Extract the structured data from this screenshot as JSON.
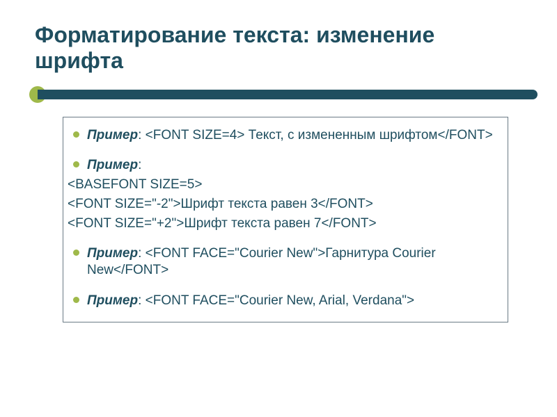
{
  "title": "Форматирование текста: изменение шрифта",
  "label": "Пример",
  "items": {
    "ex1_code": ": <FONT SIZE=4> Текст, с измененным шрифтом</FONT>",
    "ex2_sep": ":",
    "ex2_line1": "<BASEFONT SIZE=5>",
    "ex2_line2": "<FONT SIZE=\"-2\">Шрифт текста равен 3</FONT>",
    "ex2_line3": "<FONT SIZE=\"+2\">Шрифт текста равен 7</FONT>",
    "ex3_code": ": <FONT FACE=\"Courier New\">Гарнитура Courier New</FONT>",
    "ex4_code": ": <FONT FACE=\"Courier New, Arial, Verdana\">"
  }
}
